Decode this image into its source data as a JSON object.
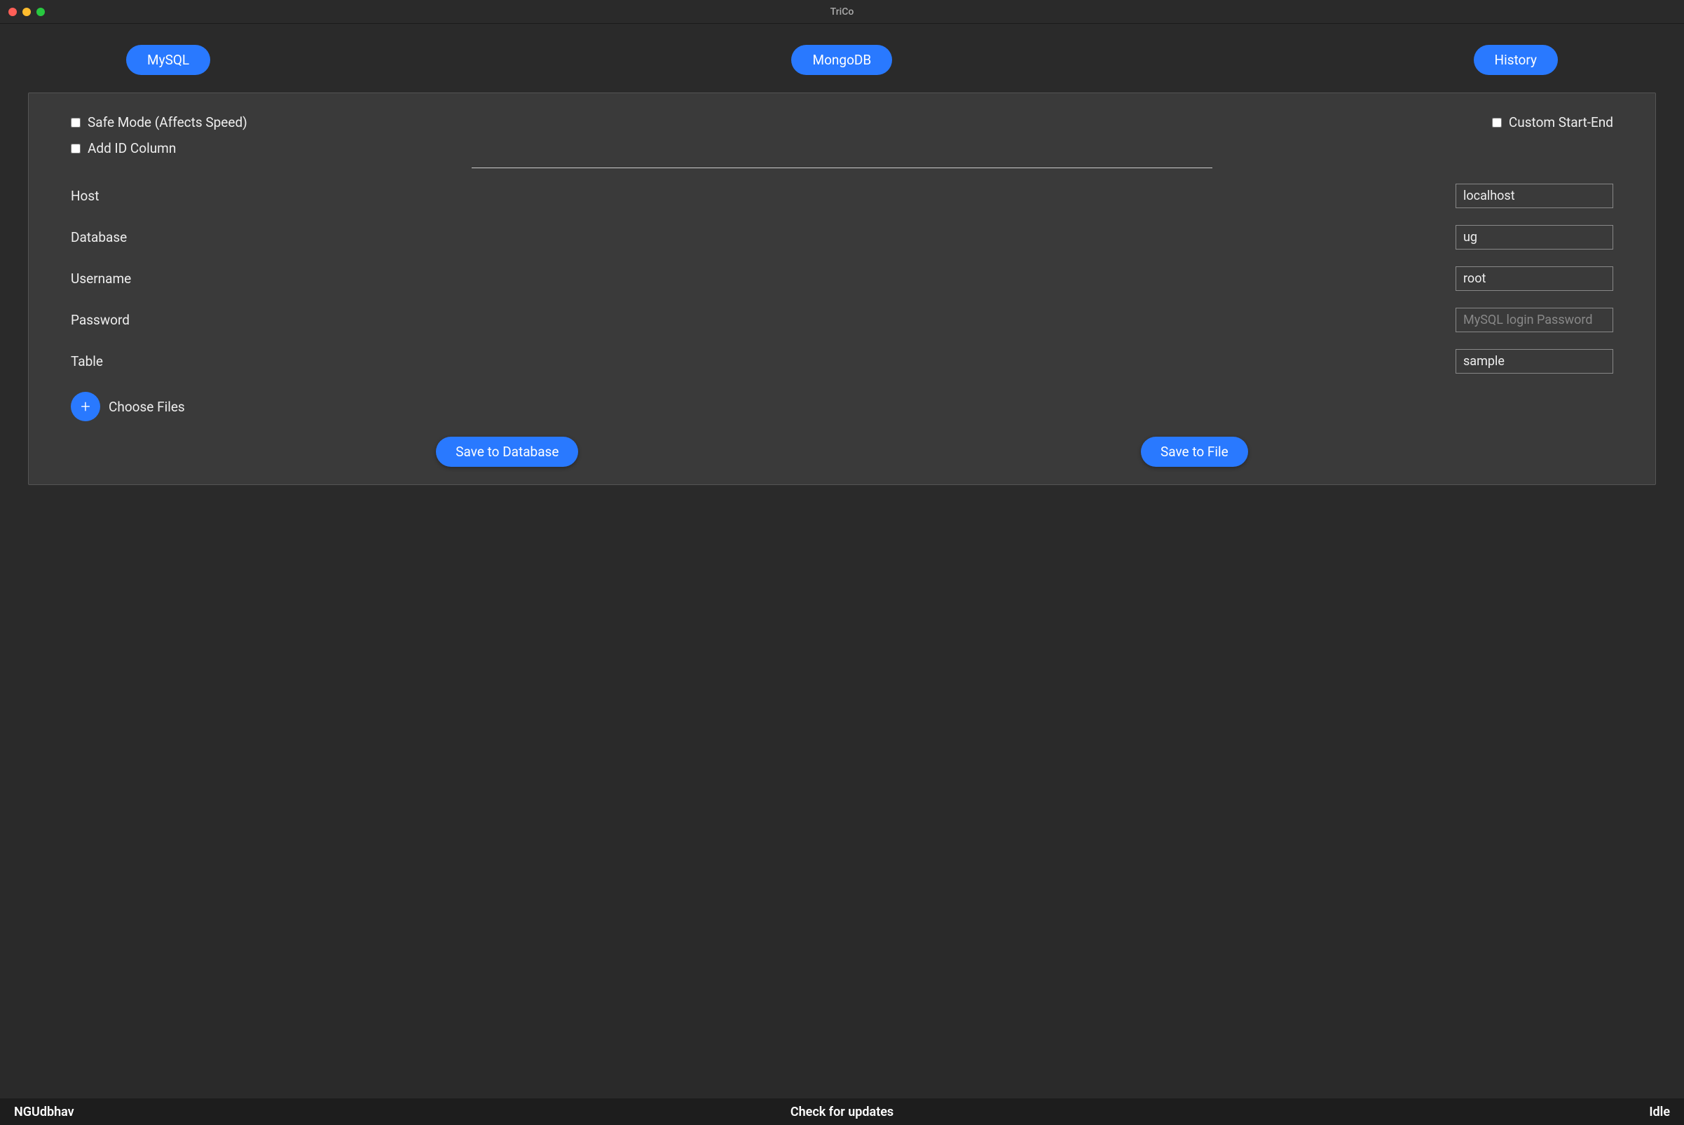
{
  "window": {
    "title": "TriCo"
  },
  "tabs": {
    "mysql": "MySQL",
    "mongodb": "MongoDB",
    "history": "History"
  },
  "checkboxes": {
    "safeMode": "Safe Mode (Affects Speed)",
    "addIdColumn": "Add ID Column",
    "customStartEnd": "Custom Start-End"
  },
  "form": {
    "host": {
      "label": "Host",
      "value": "localhost"
    },
    "database": {
      "label": "Database",
      "value": "ug"
    },
    "username": {
      "label": "Username",
      "value": "root"
    },
    "password": {
      "label": "Password",
      "placeholder": "MySQL login Password",
      "value": ""
    },
    "table": {
      "label": "Table",
      "value": "sample"
    }
  },
  "chooseFiles": "Choose Files",
  "actions": {
    "saveToDatabase": "Save to Database",
    "saveToFile": "Save to File"
  },
  "footer": {
    "left": "NGUdbhav",
    "center": "Check for updates",
    "right": "Idle"
  }
}
